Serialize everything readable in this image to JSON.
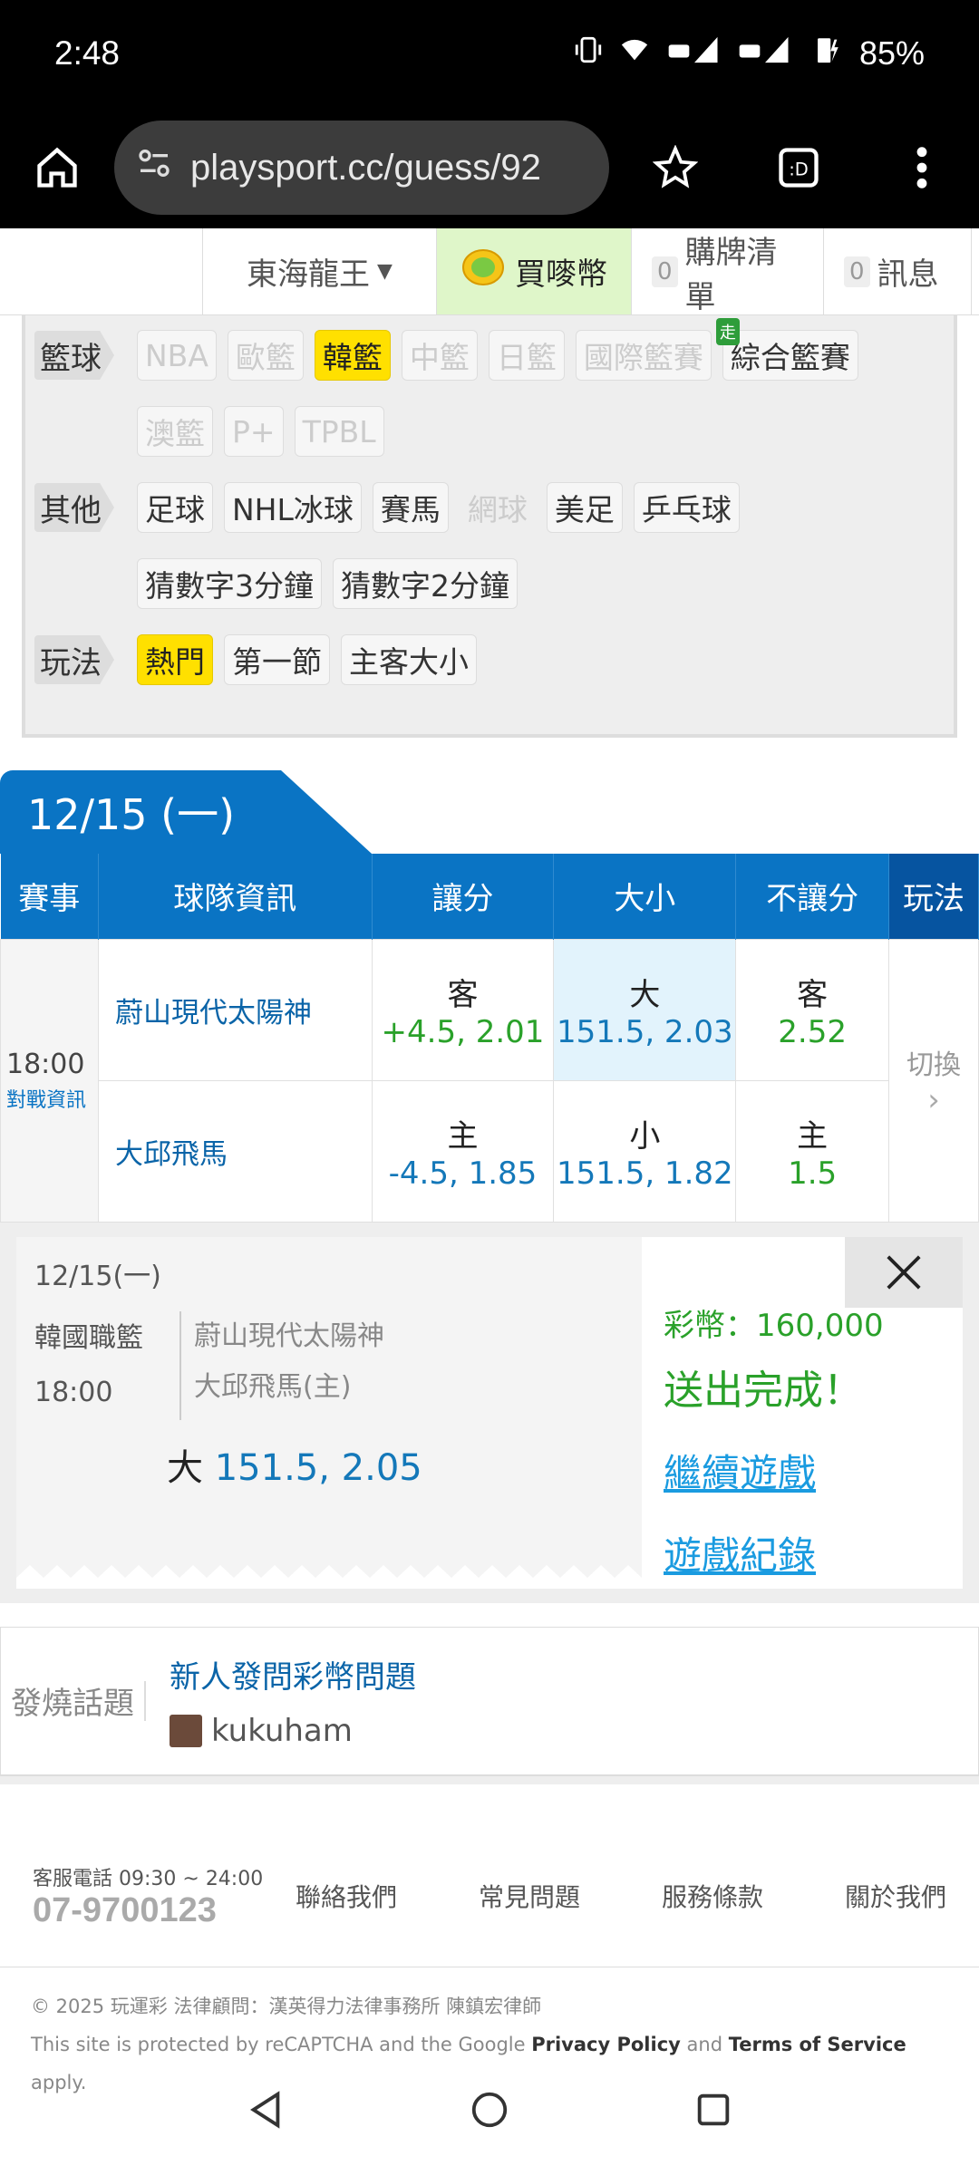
{
  "status": {
    "time": "2:48",
    "battery": "85%"
  },
  "browser": {
    "url": "playsport.cc/guess/92"
  },
  "site_header": {
    "user": "東海龍王",
    "buy_coins": "買嘜幣",
    "cart_count": "0",
    "cart": "購牌清單",
    "msg_count": "0",
    "messages": "訊息"
  },
  "filters": {
    "basketball_label": "籃球",
    "basketball": [
      "NBA",
      "歐籃",
      "韓籃",
      "中籃",
      "日籃",
      "國際籃賽",
      "綜合籃賽"
    ],
    "basketball_row2": [
      "澳籃",
      "P+",
      "TPBL"
    ],
    "walk_badge": "走",
    "other_label": "其他",
    "other": [
      "足球",
      "NHL冰球",
      "賽馬",
      "網球",
      "美足",
      "乒乓球"
    ],
    "other_row2": [
      "猜數字3分鐘",
      "猜數字2分鐘"
    ],
    "play_label": "玩法",
    "play": [
      "熱門",
      "第一節",
      "主客大小"
    ]
  },
  "date_tab": "12/15 (一)",
  "table": {
    "headers": [
      "賽事",
      "球隊資訊",
      "讓分",
      "大小",
      "不讓分",
      "玩法"
    ],
    "time": "18:00",
    "vs_info": "對戰資訊",
    "switch": "切換",
    "rows": [
      {
        "team": "蔚山現代太陽神",
        "spread_label": "客",
        "spread": "+4.5, 2.01",
        "total_label": "大",
        "total": "151.5, 2.03",
        "ml_label": "客",
        "ml": "2.52"
      },
      {
        "team": "大邱飛馬",
        "spread_label": "主",
        "spread": "-4.5, 1.85",
        "total_label": "小",
        "total": "151.5, 1.82",
        "ml_label": "主",
        "ml": "1.5"
      }
    ]
  },
  "receipt": {
    "date": "12/15(一)",
    "league": "韓國職籃",
    "time": "18:00",
    "team1": "蔚山現代太陽神",
    "team2": "大邱飛馬(主)",
    "pick_label": "大",
    "pick_value": "151.5, 2.05",
    "coins": "彩幣：160,000",
    "done": "送出完成！",
    "continue": "繼續遊戲",
    "history": "遊戲紀錄"
  },
  "hot_topic": {
    "label": "發燒話題",
    "title": "新人發問彩幣問題",
    "user": "kukuham"
  },
  "footer": {
    "service_hours": "客服電話 09:30 ~ 24:00",
    "phone": "07-9700123",
    "links": [
      "聯絡我們",
      "常見問題",
      "服務條款",
      "關於我們"
    ],
    "copyright": "© 2025 玩運彩 法律顧問：漢英得力法律事務所 陳鎮宏律師",
    "recaptcha_prefix": "This site is protected by reCAPTCHA and the Google",
    "privacy": "Privacy Policy",
    "and": "and",
    "terms": "Terms of Service",
    "apply": "apply."
  },
  "colors": {
    "brand_blue": "#0a74c4",
    "active_chip": "#ffe000",
    "success_green": "#2aa12a"
  }
}
